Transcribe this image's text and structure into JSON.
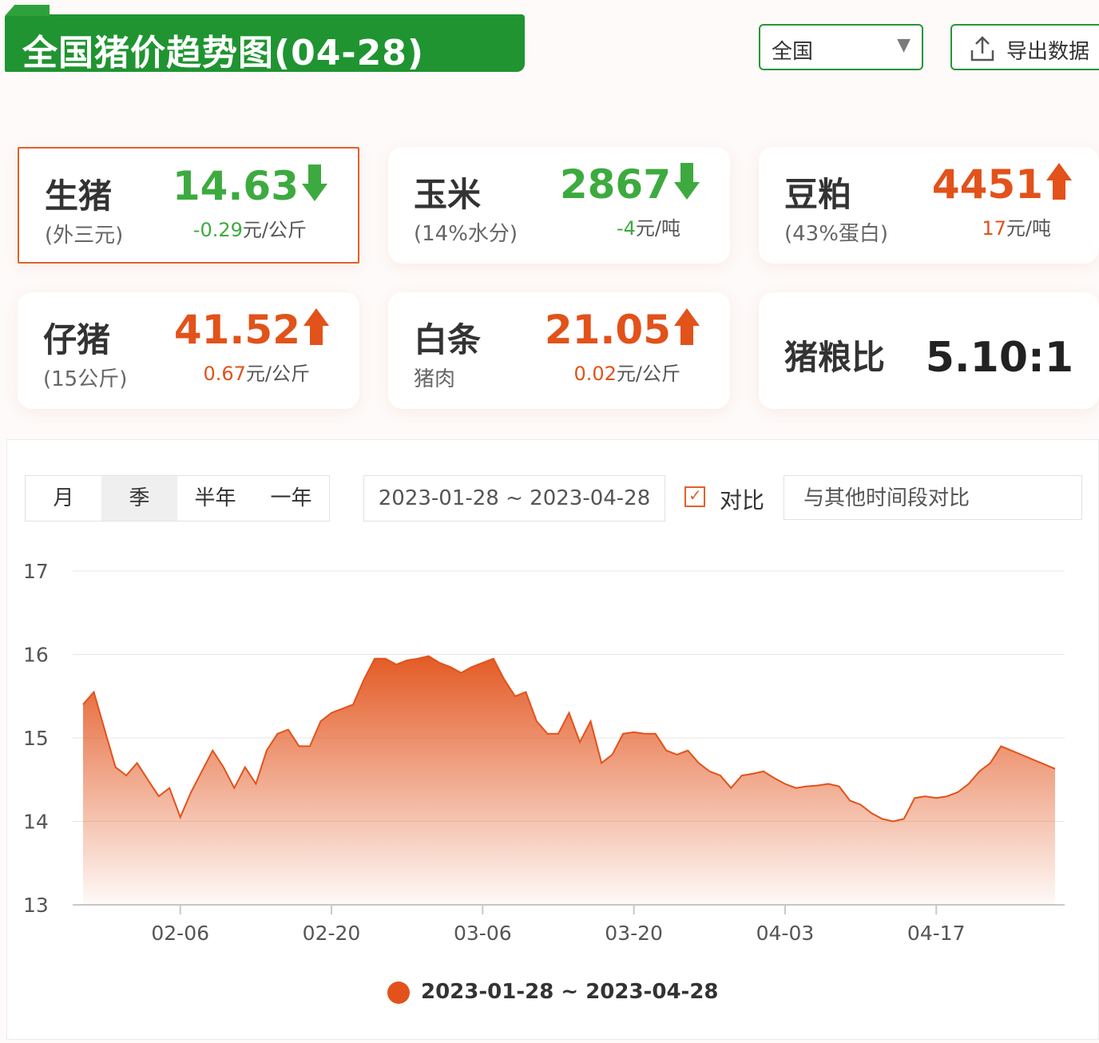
{
  "header": {
    "title": "全国猪价趋势图(04-28)",
    "region": "全国",
    "export_label": "导出数据"
  },
  "cards": [
    {
      "name": "生猪",
      "sub": "(外三元)",
      "value": "14.63",
      "direction": "down",
      "change_num": "-0.29",
      "change_unit": "元/公斤",
      "color": "#3daa3f",
      "active": true
    },
    {
      "name": "玉米",
      "sub": "(14%水分)",
      "value": "2867",
      "direction": "down",
      "change_num": "-4",
      "change_unit": "元/吨",
      "color": "#3daa3f"
    },
    {
      "name": "豆粕",
      "sub": "(43%蛋白)",
      "value": "4451",
      "direction": "up",
      "change_num": "17",
      "change_unit": "元/吨",
      "color": "#e2521a"
    },
    {
      "name": "仔猪",
      "sub": "(15公斤)",
      "value": "41.52",
      "direction": "up",
      "change_num": "0.67",
      "change_unit": "元/公斤",
      "color": "#e2521a"
    },
    {
      "name": "白条",
      "sub": "猪肉",
      "value": "21.05",
      "direction": "up",
      "change_num": "0.02",
      "change_unit": "元/公斤",
      "color": "#e2521a"
    },
    {
      "name": "猪粮比",
      "value": "5.10:1"
    }
  ],
  "controls": {
    "tabs": [
      "月",
      "季",
      "半年",
      "一年"
    ],
    "active_tab": "季",
    "date_range": "2023-01-28 ~ 2023-04-28",
    "compare_label": "对比",
    "compare_checked": true,
    "compare_placeholder": "与其他时间段对比"
  },
  "chart_data": {
    "type": "area",
    "y_ticks": [
      13,
      14,
      15,
      16,
      17
    ],
    "ylim": [
      13,
      17
    ],
    "x_tick_labels": [
      "02-06",
      "02-20",
      "03-06",
      "03-20",
      "04-03",
      "04-17"
    ],
    "color": "#e2521a",
    "series": [
      {
        "name": "2023-01-28 ~ 2023-04-28",
        "points": [
          [
            "2023-01-28",
            15.4
          ],
          [
            "2023-01-29",
            15.55
          ],
          [
            "2023-01-30",
            15.1
          ],
          [
            "2023-01-31",
            14.65
          ],
          [
            "2023-02-01",
            14.55
          ],
          [
            "2023-02-02",
            14.7
          ],
          [
            "2023-02-03",
            14.5
          ],
          [
            "2023-02-04",
            14.3
          ],
          [
            "2023-02-05",
            14.4
          ],
          [
            "2023-02-06",
            14.05
          ],
          [
            "2023-02-07",
            14.35
          ],
          [
            "2023-02-08",
            14.6
          ],
          [
            "2023-02-09",
            14.85
          ],
          [
            "2023-02-10",
            14.65
          ],
          [
            "2023-02-11",
            14.4
          ],
          [
            "2023-02-12",
            14.65
          ],
          [
            "2023-02-13",
            14.45
          ],
          [
            "2023-02-14",
            14.85
          ],
          [
            "2023-02-15",
            15.05
          ],
          [
            "2023-02-16",
            15.1
          ],
          [
            "2023-02-17",
            14.9
          ],
          [
            "2023-02-18",
            14.9
          ],
          [
            "2023-02-19",
            15.2
          ],
          [
            "2023-02-20",
            15.3
          ],
          [
            "2023-02-21",
            15.35
          ],
          [
            "2023-02-22",
            15.4
          ],
          [
            "2023-02-23",
            15.7
          ],
          [
            "2023-02-24",
            15.95
          ],
          [
            "2023-02-25",
            15.95
          ],
          [
            "2023-02-26",
            15.88
          ],
          [
            "2023-02-27",
            15.93
          ],
          [
            "2023-02-28",
            15.95
          ],
          [
            "2023-03-01",
            15.98
          ],
          [
            "2023-03-02",
            15.9
          ],
          [
            "2023-03-03",
            15.85
          ],
          [
            "2023-03-04",
            15.78
          ],
          [
            "2023-03-05",
            15.85
          ],
          [
            "2023-03-06",
            15.9
          ],
          [
            "2023-03-07",
            15.95
          ],
          [
            "2023-03-08",
            15.7
          ],
          [
            "2023-03-09",
            15.5
          ],
          [
            "2023-03-10",
            15.55
          ],
          [
            "2023-03-11",
            15.2
          ],
          [
            "2023-03-12",
            15.05
          ],
          [
            "2023-03-13",
            15.05
          ],
          [
            "2023-03-14",
            15.3
          ],
          [
            "2023-03-15",
            14.95
          ],
          [
            "2023-03-16",
            15.2
          ],
          [
            "2023-03-17",
            14.7
          ],
          [
            "2023-03-18",
            14.8
          ],
          [
            "2023-03-19",
            15.05
          ],
          [
            "2023-03-20",
            15.07
          ],
          [
            "2023-03-21",
            15.05
          ],
          [
            "2023-03-22",
            15.05
          ],
          [
            "2023-03-23",
            14.85
          ],
          [
            "2023-03-24",
            14.8
          ],
          [
            "2023-03-25",
            14.85
          ],
          [
            "2023-03-26",
            14.7
          ],
          [
            "2023-03-27",
            14.6
          ],
          [
            "2023-03-28",
            14.55
          ],
          [
            "2023-03-29",
            14.4
          ],
          [
            "2023-03-30",
            14.55
          ],
          [
            "2023-03-31",
            14.57
          ],
          [
            "2023-04-01",
            14.6
          ],
          [
            "2023-04-02",
            14.52
          ],
          [
            "2023-04-03",
            14.45
          ],
          [
            "2023-04-04",
            14.4
          ],
          [
            "2023-04-05",
            14.42
          ],
          [
            "2023-04-06",
            14.43
          ],
          [
            "2023-04-07",
            14.45
          ],
          [
            "2023-04-08",
            14.42
          ],
          [
            "2023-04-09",
            14.25
          ],
          [
            "2023-04-10",
            14.2
          ],
          [
            "2023-04-11",
            14.1
          ],
          [
            "2023-04-12",
            14.03
          ],
          [
            "2023-04-13",
            14.0
          ],
          [
            "2023-04-14",
            14.03
          ],
          [
            "2023-04-15",
            14.28
          ],
          [
            "2023-04-16",
            14.3
          ],
          [
            "2023-04-17",
            14.28
          ],
          [
            "2023-04-18",
            14.3
          ],
          [
            "2023-04-19",
            14.35
          ],
          [
            "2023-04-20",
            14.45
          ],
          [
            "2023-04-21",
            14.6
          ],
          [
            "2023-04-22",
            14.7
          ],
          [
            "2023-04-23",
            14.9
          ],
          [
            "2023-04-28",
            14.63
          ]
        ]
      }
    ]
  }
}
